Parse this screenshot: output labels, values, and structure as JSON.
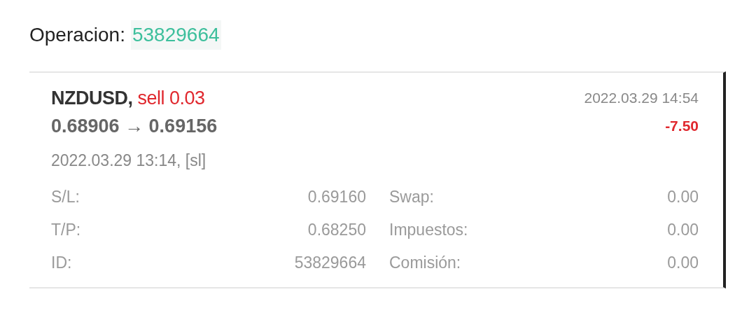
{
  "header": {
    "label": "Operacion:",
    "ticket": "53829664"
  },
  "deal": {
    "symbol": "NZDUSD,",
    "side": "sell 0.03",
    "close_time": "2022.03.29 14:54",
    "prices": "0.68906 → 0.69156",
    "profit": "-7.50",
    "open_time": "2022.03.29 13:14, [sl]",
    "details": [
      {
        "label": "S/L:",
        "value": "0.69160",
        "label_2": "Swap:",
        "value_2": "0.00"
      },
      {
        "label": "T/P:",
        "value": "0.68250",
        "label_2": "Impuestos:",
        "value_2": "0.00"
      },
      {
        "label": "ID:",
        "value": "53829664",
        "label_2": "Comisión:",
        "value_2": "0.00"
      }
    ]
  }
}
